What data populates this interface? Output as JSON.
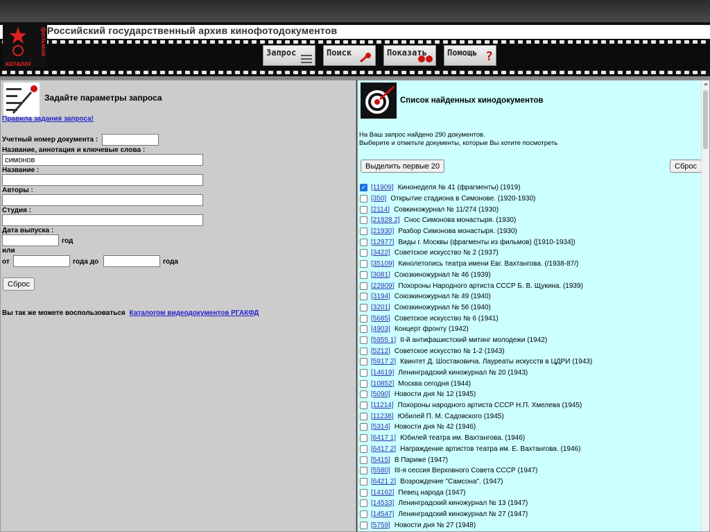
{
  "header": {
    "site_title": "Российский государственный архив кинофотодокументов",
    "logo_text": "каталог фильмов",
    "nav": [
      {
        "label": "Запрос",
        "icon": "lines-icon"
      },
      {
        "label": "Поиск",
        "icon": "magnifier-icon"
      },
      {
        "label": "Показать",
        "icon": "dots-icon"
      },
      {
        "label": "Помощь",
        "icon": "question-icon"
      }
    ]
  },
  "query": {
    "title": "Задайте параметры запроса",
    "rules_link": "Правила задания запроса!",
    "doc_number_label": "Учетный номер документа :",
    "doc_number_value": "",
    "keywords_label": "Название, аннотация и ключевые слова :",
    "keywords_value": "симонов",
    "name_label": "Название :",
    "name_value": "",
    "authors_label": "Авторы :",
    "authors_value": "",
    "studio_label": "Студия :",
    "studio_value": "",
    "release_label": "Дата выпуска :",
    "year_word": "год",
    "or_word": "или",
    "from_word": "от",
    "year_to_word": "года до",
    "year_word2": "года",
    "reset_label": "Сброс",
    "also_text": "Вы так же можете воспользоваться",
    "also_link": "Каталогом видеодокументов РГАКФД"
  },
  "results": {
    "title": "Список найденных кинодокументов",
    "found_line1": "На Ваш запрос найдено 290 документов.",
    "found_line2": "Выберите и отметьте документы, которые Вы хотите посмотреть",
    "select_first_label": "Выделить первые 20",
    "reset_label": "Сброс",
    "items": [
      {
        "checked": true,
        "id": "[11909]",
        "title": "Кинонеделя № 41 (фрагменты) (1919)"
      },
      {
        "checked": false,
        "id": "[350]",
        "title": "Открытие стадиона в Симонове. (1920-1930)"
      },
      {
        "checked": false,
        "id": "[2114]",
        "title": "Совкиножурнал № 11/274 (1930)"
      },
      {
        "checked": false,
        "id": "[21928 2]",
        "title": "Снос Симонова монастыря. (1930)"
      },
      {
        "checked": false,
        "id": "[21930]",
        "title": "Разбор Симонова монастыря. (1930)"
      },
      {
        "checked": false,
        "id": "[12977]",
        "title": "Виды г. Москвы (фрагменты из фильмов) ([1910-1934])"
      },
      {
        "checked": false,
        "id": "[3422]",
        "title": "Советское искусство № 2 (1937)"
      },
      {
        "checked": false,
        "id": "[35109]",
        "title": "Кинолетопись театра имени Евг. Вахтангова. (/1938-87/)"
      },
      {
        "checked": false,
        "id": "[3081]",
        "title": "Союзкиножурнал № 46 (1939)"
      },
      {
        "checked": false,
        "id": "[22809]",
        "title": "Похороны Народного артиста СССР Б. В. Щукина. (1939)"
      },
      {
        "checked": false,
        "id": "[3194]",
        "title": "Союзкиножурнал № 49 (1940)"
      },
      {
        "checked": false,
        "id": "[3201]",
        "title": "Союзкиножурнал № 56 (1940)"
      },
      {
        "checked": false,
        "id": "[5685]",
        "title": "Советское искусство № 6 (1941)"
      },
      {
        "checked": false,
        "id": "[4903]",
        "title": "Концерт фронту (1942)"
      },
      {
        "checked": false,
        "id": "[5955 1]",
        "title": "II-й антифашистский митинг молодежи (1942)"
      },
      {
        "checked": false,
        "id": "[5212]",
        "title": "Советское искусство № 1-2 (1943)"
      },
      {
        "checked": false,
        "id": "[5917 2]",
        "title": "Квинтет Д. Шостаковича. Лауреаты искусств в ЦДРИ (1943)"
      },
      {
        "checked": false,
        "id": "[14619]",
        "title": "Ленинградский киножурнал № 20 (1943)"
      },
      {
        "checked": false,
        "id": "[10852]",
        "title": "Москва сегодня (1944)"
      },
      {
        "checked": false,
        "id": "[5090]",
        "title": "Новости дня № 12 (1945)"
      },
      {
        "checked": false,
        "id": "[11214]",
        "title": "Похороны народного артиста СССР Н.П. Хмелева (1945)"
      },
      {
        "checked": false,
        "id": "[11238]",
        "title": "Юбилей П. М. Садовского (1945)"
      },
      {
        "checked": false,
        "id": "[5314]",
        "title": "Новости дня № 42 (1946)"
      },
      {
        "checked": false,
        "id": "[6417 1]",
        "title": "Юбилей театра им. Вахтангова. (1946)"
      },
      {
        "checked": false,
        "id": "[6417 2]",
        "title": "Награждение артистов театра им. Е. Вахтангова. (1946)"
      },
      {
        "checked": false,
        "id": "[5415]",
        "title": "В Париже (1947)"
      },
      {
        "checked": false,
        "id": "[5580]",
        "title": "III-я сессия Верховного Совета СССР (1947)"
      },
      {
        "checked": false,
        "id": "[6421 2]",
        "title": "Возрождение \"Самсона\". (1947)"
      },
      {
        "checked": false,
        "id": "[14162]",
        "title": "Певец народа (1947)"
      },
      {
        "checked": false,
        "id": "[14533]",
        "title": "Ленинградский киножурнал № 13 (1947)"
      },
      {
        "checked": false,
        "id": "[14547]",
        "title": "Ленинградский киножурнал № 27 (1947)"
      },
      {
        "checked": false,
        "id": "[5759]",
        "title": "Новости дня № 27 (1948)"
      }
    ]
  },
  "colors": {
    "left_bg": "#cccccc",
    "right_bg": "#ccffff",
    "link": "#2222cc"
  }
}
